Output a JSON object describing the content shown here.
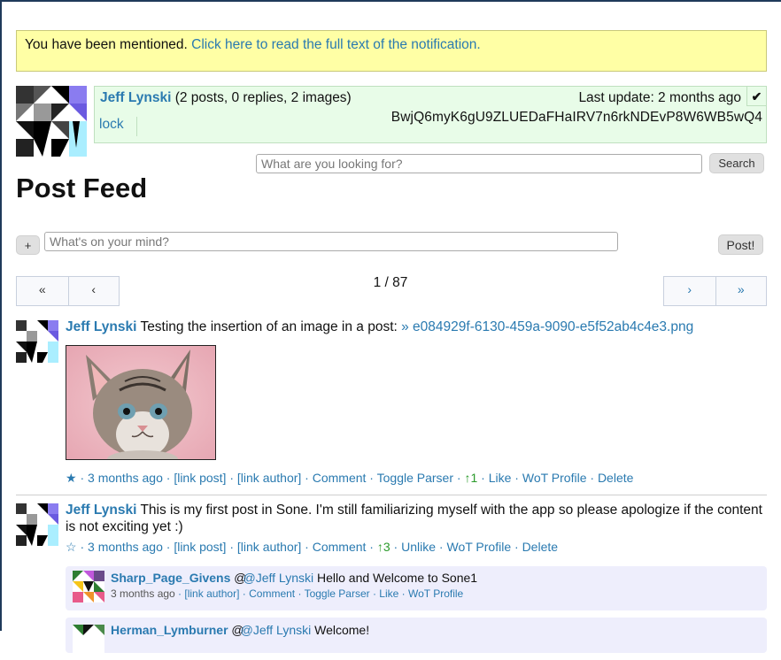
{
  "notification": {
    "text": "You have been mentioned.",
    "link": "Click here to read the full text of the notification."
  },
  "profile": {
    "name": "Jeff Lynski",
    "counts": "(2 posts, 0 replies, 2 images)",
    "last_update": "Last update: 2 months ago",
    "check": "✔",
    "id": "BwjQ6myK6gU9ZLUEDaFHaIRV7n6rkNDEvP8W6WB5wQ4",
    "lock": "lock"
  },
  "search": {
    "placeholder": "What are you looking for?",
    "button": "Search"
  },
  "page_title": "Post Feed",
  "composer": {
    "plus": "+",
    "placeholder": "What's on your mind?",
    "button": "Post!"
  },
  "pagination": {
    "first": "«",
    "prev": "‹",
    "indicator": "1 / 87",
    "next": "›",
    "last": "»"
  },
  "posts": [
    {
      "author": "Jeff Lynski",
      "text": "Testing the insertion of an image in a post:",
      "link": "» e084929f-6130-459a-9090-e5f52ab4c4e3.png",
      "status": {
        "star": "★",
        "time": "3 months ago",
        "link_post": "[link post]",
        "link_author": "[link author]",
        "comment": "Comment",
        "toggle": "Toggle Parser",
        "likes": "↑1",
        "like": "Like",
        "wot": "WoT Profile",
        "delete": "Delete"
      }
    },
    {
      "author": "Jeff Lynski",
      "text": "This is my first post in Sone. I'm still familiarizing myself with the app so please apologize if the content is not exciting yet :)",
      "status": {
        "star": "☆",
        "time": "3 months ago",
        "link_post": "[link post]",
        "link_author": "[link author]",
        "comment": "Comment",
        "likes": "↑3",
        "unlike": "Unlike",
        "wot": "WoT Profile",
        "delete": "Delete"
      },
      "replies": [
        {
          "author": "Sharp_Page_Givens",
          "mention": "@Jeff Lynski",
          "text": "Hello and Welcome to Sone1",
          "time": "3 months ago",
          "link_author": "[link author]",
          "comment": "Comment",
          "toggle": "Toggle Parser",
          "like": "Like",
          "wot": "WoT Profile"
        },
        {
          "author": "Herman_Lymburner",
          "mention": "@Jeff Lynski",
          "text": "Welcome!"
        }
      ]
    }
  ]
}
